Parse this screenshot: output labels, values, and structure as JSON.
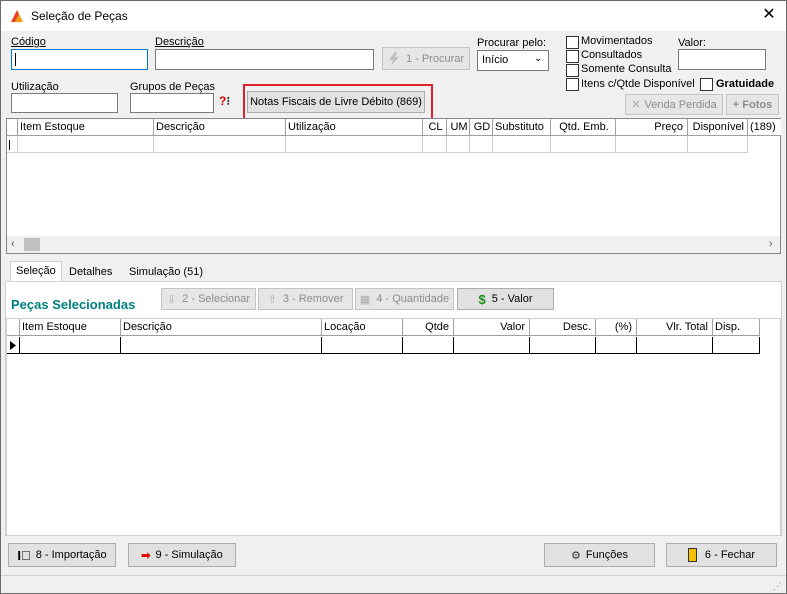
{
  "window": {
    "title": "Seleção de Peças"
  },
  "filters": {
    "codigo_label": "Código",
    "codigo_value": "",
    "descricao_label": "Descrição",
    "descricao_value": "",
    "utilizacao_label": "Utilização",
    "utilizacao_value": "",
    "grupos_label": "Grupos de Peças",
    "grupos_value": "",
    "procurar_pelo_label": "Procurar pelo:",
    "procurar_pelo_value": "Início",
    "valor_label": "Valor:",
    "valor_value": "",
    "search_button": "1 - Procurar",
    "notas_button": "Notas Fiscais de Livre Débito (869)",
    "venda_perdida_button": "Venda Perdida",
    "fotos_button": "+ Fotos"
  },
  "checkboxes": [
    {
      "label": "Movimentados",
      "checked": false
    },
    {
      "label": "Consultados",
      "checked": false
    },
    {
      "label": "Somente Consulta",
      "checked": false
    },
    {
      "label": "Itens c/Qtde Disponível",
      "checked": false
    },
    {
      "label": "Gratuidade",
      "checked": false
    }
  ],
  "top_grid": {
    "columns": [
      "Item Estoque",
      "Descrição",
      "Utilização",
      "CL",
      "UM",
      "GD",
      "Substituto",
      "Qtd. Emb.",
      "Preço",
      "Disponível",
      "(189)"
    ]
  },
  "tabs": [
    {
      "label": "Seleção",
      "active": true
    },
    {
      "label": "Detalhes",
      "active": false
    },
    {
      "label": "Simulação (51)",
      "active": false
    }
  ],
  "selected": {
    "heading": "Peças Selecionadas",
    "btn_selecionar": "2 - Selecionar",
    "btn_remover": "3 - Remover",
    "btn_quantidade": "4 - Quantidade",
    "btn_valor": "5 - Valor",
    "columns": [
      "Item Estoque",
      "Descrição",
      "Locação",
      "Qtde",
      "Valor",
      "Desc.",
      "(%)",
      "Vlr. Total",
      "Disp."
    ]
  },
  "footer": {
    "importacao": "8 - Importação",
    "simulacao": "9 - Simulação",
    "funcoes": "Funções",
    "fechar": "6 - Fechar"
  },
  "colors": {
    "accent_teal": "#008080",
    "highlight_red": "#e0202a",
    "focus_blue": "#0078d7",
    "dollar_green": "#1a8f1a"
  }
}
